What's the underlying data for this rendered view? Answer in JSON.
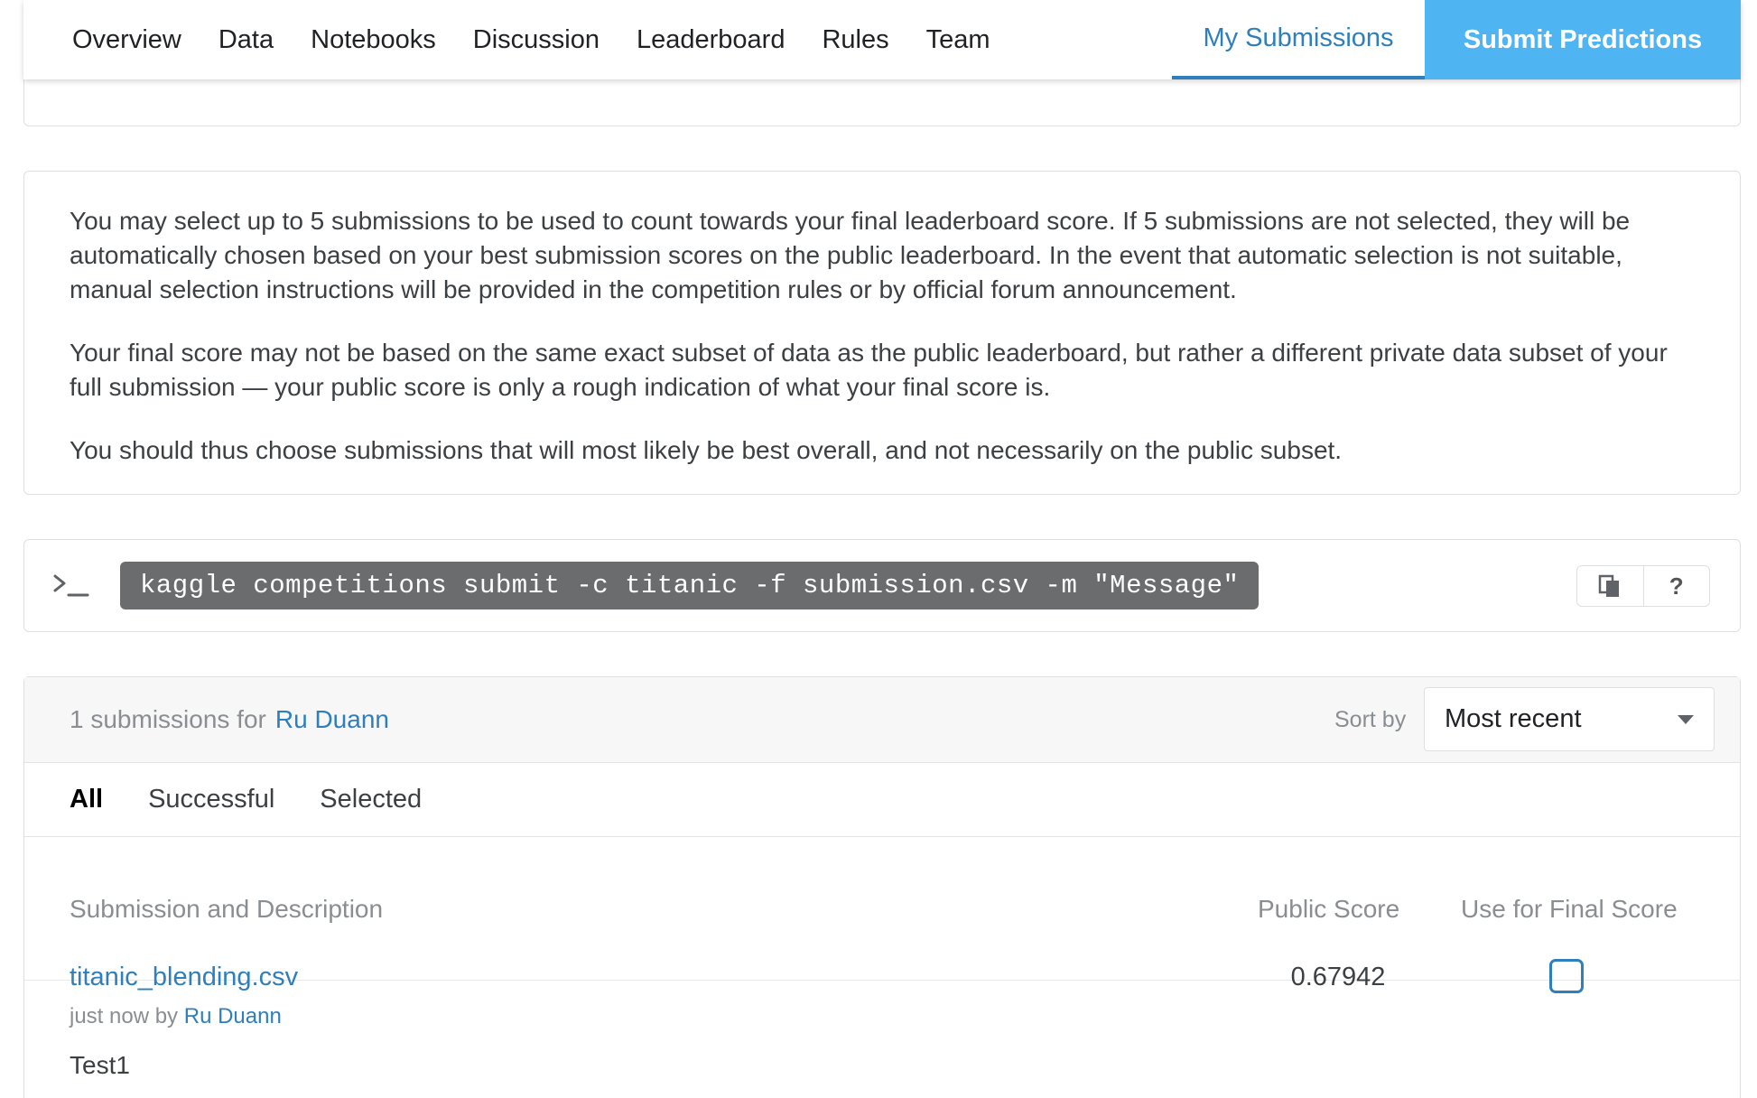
{
  "nav": {
    "tabs": [
      "Overview",
      "Data",
      "Notebooks",
      "Discussion",
      "Leaderboard",
      "Rules",
      "Team"
    ],
    "my_submissions": "My Submissions",
    "submit_predictions": "Submit Predictions"
  },
  "info": {
    "paragraphs": [
      "You may select up to 5 submissions to be used to count towards your final leaderboard score. If 5 submissions are not selected, they will be automatically chosen based on your best submission scores on the public leaderboard. In the event that automatic selection is not suitable, manual selection instructions will be provided in the competition rules or by official forum announcement.",
      "Your final score may not be based on the same exact subset of data as the public leaderboard, but rather a different private data subset of your full submission — your public score is only a rough indication of what your final score is.",
      "You should thus choose submissions that will most likely be best overall, and not necessarily on the public subset."
    ]
  },
  "command": {
    "text": "kaggle competitions submit -c titanic -f submission.csv -m \"Message\"",
    "help": "?"
  },
  "submissions": {
    "count_text": "1 submissions for",
    "user": "Ru Duann",
    "sort_label": "Sort by",
    "sort_value": "Most recent",
    "filters": [
      "All",
      "Successful",
      "Selected"
    ],
    "columns": {
      "description": "Submission and Description",
      "public_score": "Public Score",
      "final_score": "Use for Final Score"
    },
    "rows": [
      {
        "file": "titanic_blending.csv",
        "meta_prefix": "just now by",
        "meta_user": "Ru Duann",
        "description": "Test1",
        "public_score": "0.67942",
        "selected": false
      }
    ]
  },
  "colors": {
    "accent": "#2f7fbd",
    "submit_bg": "#4fb5f2"
  }
}
